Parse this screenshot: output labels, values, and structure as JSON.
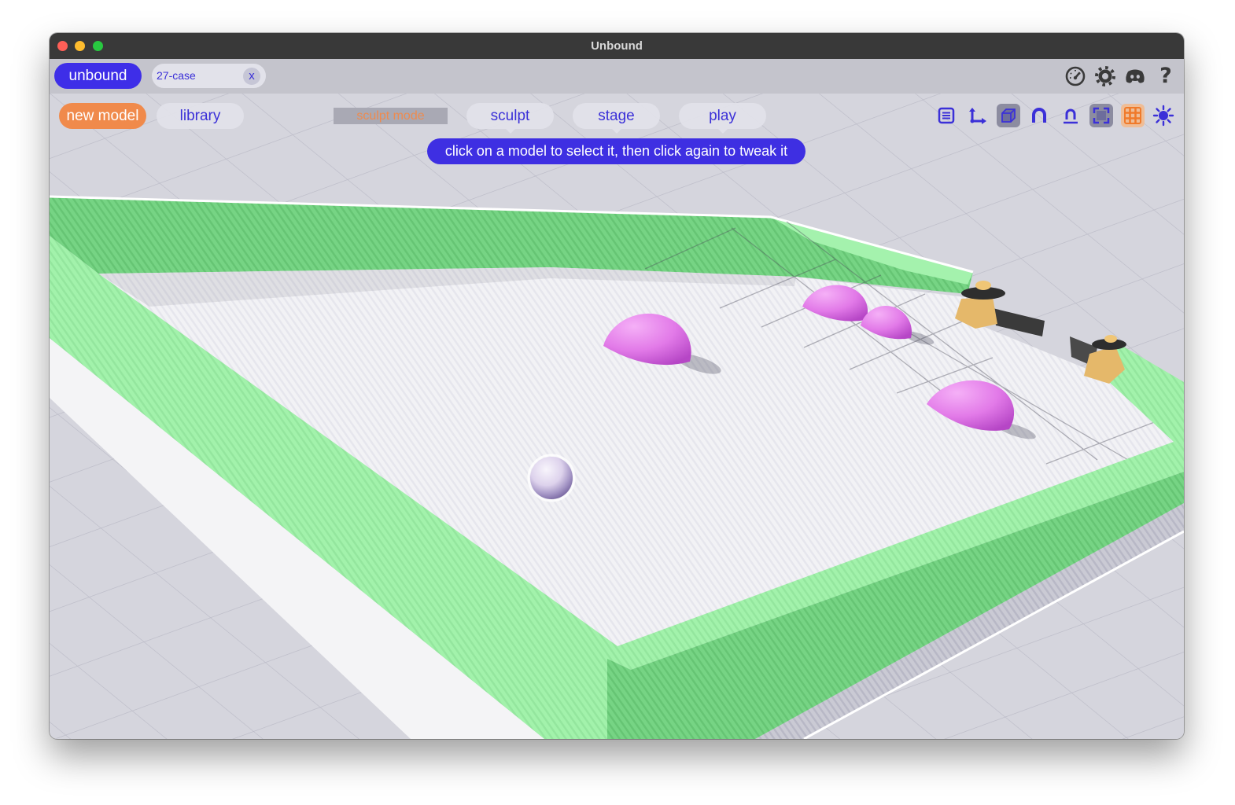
{
  "window": {
    "title": "Unbound"
  },
  "tabbar": {
    "brand_label": "unbound",
    "tab": {
      "label": "27-case",
      "close_label": "x"
    },
    "icons": [
      "gauge-icon",
      "gear-icon",
      "discord-icon",
      "help-icon"
    ],
    "help_glyph": "?"
  },
  "toolbar": {
    "new_model_label": "new model",
    "library_label": "library",
    "mode_label": "sculpt mode",
    "modes": [
      "sculpt",
      "stage",
      "play"
    ],
    "hint": "click on a model to select it, then click again to tweak it",
    "tools": [
      "list-icon",
      "axis-icon",
      "cube-icon",
      "magnet-icon",
      "magnet-base-icon",
      "frame-icon",
      "grid-icon",
      "sun-icon"
    ]
  },
  "colors": {
    "accent": "#3e2ee8",
    "new_model": "#f08a4b",
    "wall_green": "#a2f2ab",
    "dome_pink": "#e27ae8",
    "ball": "#ddd2ec",
    "cannon_base": "#e5b86a"
  }
}
